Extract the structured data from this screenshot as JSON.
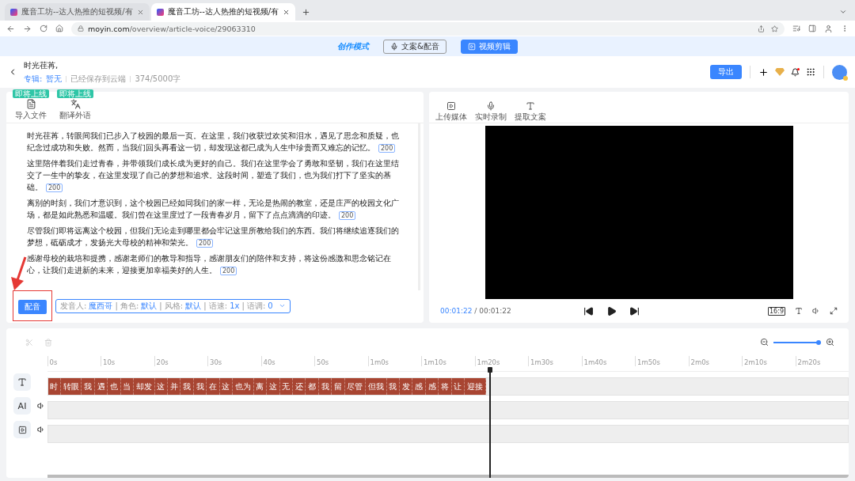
{
  "browser": {
    "tabs": [
      {
        "title": "魔音工坊--达人热推的短视频/有",
        "selected": false
      },
      {
        "title": "魔音工坊--达人热推的短视频/有",
        "selected": true
      }
    ],
    "url_host": "moyin.com",
    "url_path": "/overview/article-voice/29063310"
  },
  "mode_bar": {
    "logo": "创作模式",
    "buttons": [
      {
        "label": "文案&配音",
        "selected": false
      },
      {
        "label": "视频剪辑",
        "selected": true
      }
    ]
  },
  "header": {
    "title": "时光荏苒,",
    "album_label": "专辑:",
    "album": "暂无",
    "save_status": "已经保存到云端",
    "char_count": "374/5000字",
    "export": "导出"
  },
  "editor": {
    "tools": [
      {
        "label": "导入文件",
        "badge": "即将上线",
        "kind": "file"
      },
      {
        "label": "翻译外语",
        "badge": "即将上线",
        "kind": "translate"
      }
    ],
    "paragraphs": [
      {
        "text": "时光荏苒，转眼间我们已步入了校园的最后一页。在这里，我们收获过欢笑和泪水，遇见了思念和质疑，也纪念过成功和失败。然而，当我们回头再看这一切，却发现这都已成为人生中珍贵而又难忘的记忆。",
        "count": "200"
      },
      {
        "text": "这里陪伴着我们走过青春，并带领我们成长成为更好的自己。我们在这里学会了勇敢和坚韧，我们在这里结交了一生中的挚友，在这里发现了自己的梦想和追求。这段时间，塑造了我们，也为我们打下了坚实的基础。",
        "count": "200"
      },
      {
        "text": "离别的时刻，我们才意识到，这个校园已经如同我们的家一样，无论是热闹的教室，还是庄严的校园文化广场，都是如此熟悉和温暖。我们曾在这里度过了一段青春岁月，留下了点点滴滴的印迹。",
        "count": "200"
      },
      {
        "text": "尽管我们即将远离这个校园，但我们无论走到哪里都会牢记这里所教给我们的东西。我们将继续追逐我们的梦想，砥砺成才，发扬光大母校的精神和荣光。",
        "count": "200"
      },
      {
        "text": "感谢母校的栽培和提携，感谢老师们的教导和指导，感谢朋友们的陪伴和支持，将这份感激和思念铭记在心，让我们走进新的未来，迎接更加幸福美好的人生。",
        "count": "200"
      }
    ],
    "dub_button": "配音",
    "voice_settings": [
      {
        "label": "发音人:",
        "value": "魔西哥"
      },
      {
        "label": "| 角色:",
        "value": "默认"
      },
      {
        "label": "| 风格:",
        "value": "默认"
      },
      {
        "label": "| 语速:",
        "value": "1x"
      },
      {
        "label": "| 语调:",
        "value": "0"
      }
    ]
  },
  "player": {
    "tools": [
      {
        "label": "上传媒体",
        "kind": "media"
      },
      {
        "label": "实时录制",
        "kind": "mic"
      },
      {
        "label": "提取文案",
        "kind": "text"
      }
    ],
    "current": "00:01:22",
    "total": "/ 00:01:22",
    "ratio": "16:9"
  },
  "timeline": {
    "zoom": {
      "level": 0.95
    },
    "ticks": [
      "0s",
      "10s",
      "20s",
      "30s",
      "40s",
      "50s",
      "1m0s",
      "1m10s",
      "1m20s",
      "1m30s",
      "1m40s",
      "1m50s",
      "2m0s",
      "2m10s",
      "2m20s"
    ],
    "playhead": {
      "level": 0.553
    },
    "tracks": [
      {
        "kind": "text",
        "clips": [
          "时",
          "转眼",
          "我",
          "遇",
          "也",
          "当",
          "却发",
          "这",
          "并",
          "我",
          "我",
          "在",
          "这",
          "也为",
          "离",
          "这",
          "无",
          "还",
          "都",
          "我",
          "留",
          "尽管",
          "但我",
          "我",
          "发",
          "感",
          "感",
          "将",
          "让",
          "迎接"
        ]
      },
      {
        "kind": "ai",
        "label": "AI"
      },
      {
        "kind": "video"
      }
    ]
  }
}
